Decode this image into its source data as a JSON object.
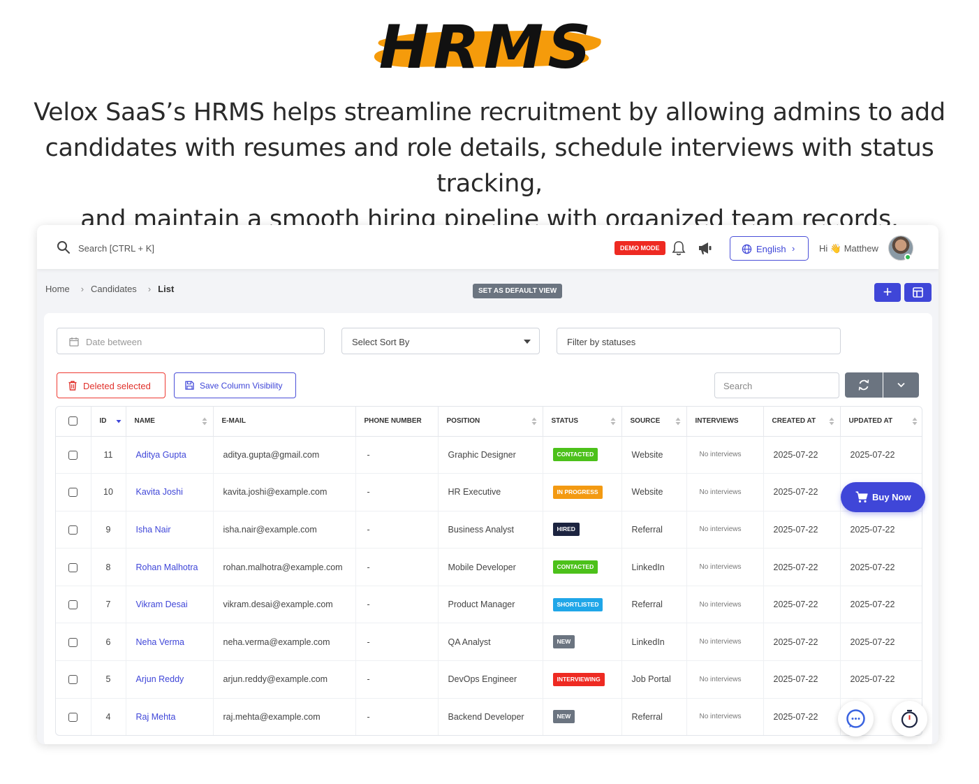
{
  "hero": {
    "logo_text": "HRMS",
    "description_lines": [
      "Velox SaaS’s HRMS helps streamline recruitment by allowing admins to add",
      "candidates with resumes and role details, schedule interviews with status tracking,",
      "and maintain a smooth hiring pipeline with organized team records."
    ]
  },
  "topbar": {
    "search_placeholder": "Search [CTRL + K]",
    "demo_badge": "DEMO MODE",
    "language": "English",
    "greeting_prefix": "Hi",
    "greeting_emoji": "👋",
    "user_name": "Matthew"
  },
  "breadcrumb": {
    "home": "Home",
    "section": "Candidates",
    "current": "List"
  },
  "set_default_view": "SET AS DEFAULT VIEW",
  "filters": {
    "date_placeholder": "Date between",
    "sort_placeholder": "Select Sort By",
    "status_placeholder": "Filter by statuses"
  },
  "actions": {
    "delete_selected": "Deleted selected",
    "save_column_visibility": "Save Column Visibility",
    "search_placeholder": "Search"
  },
  "table": {
    "columns": [
      "ID",
      "NAME",
      "E-MAIL",
      "PHONE NUMBER",
      "POSITION",
      "STATUS",
      "SOURCE",
      "INTERVIEWS",
      "CREATED AT",
      "UPDATED AT"
    ],
    "rows": [
      {
        "id": "11",
        "name": "Aditya Gupta",
        "email": "aditya.gupta@gmail.com",
        "phone": "-",
        "position": "Graphic Designer",
        "status": "CONTACTED",
        "status_color": "#4cc11a",
        "source": "Website",
        "interviews": "No interviews",
        "created": "2025-07-22",
        "updated": "2025-07-22"
      },
      {
        "id": "10",
        "name": "Kavita Joshi",
        "email": "kavita.joshi@example.com",
        "phone": "-",
        "position": "HR Executive",
        "status": "IN PROGRESS",
        "status_color": "#f39a12",
        "source": "Website",
        "interviews": "No interviews",
        "created": "2025-07-22",
        "updated": ""
      },
      {
        "id": "9",
        "name": "Isha Nair",
        "email": "isha.nair@example.com",
        "phone": "-",
        "position": "Business Analyst",
        "status": "HIRED",
        "status_color": "#1c2440",
        "source": "Referral",
        "interviews": "No interviews",
        "created": "2025-07-22",
        "updated": "2025-07-22"
      },
      {
        "id": "8",
        "name": "Rohan Malhotra",
        "email": "rohan.malhotra@example.com",
        "phone": "-",
        "position": "Mobile Developer",
        "status": "CONTACTED",
        "status_color": "#4cc11a",
        "source": "LinkedIn",
        "interviews": "No interviews",
        "created": "2025-07-22",
        "updated": "2025-07-22"
      },
      {
        "id": "7",
        "name": "Vikram Desai",
        "email": "vikram.desai@example.com",
        "phone": "-",
        "position": "Product Manager",
        "status": "SHORTLISTED",
        "status_color": "#1fa6e8",
        "source": "Referral",
        "interviews": "No interviews",
        "created": "2025-07-22",
        "updated": "2025-07-22"
      },
      {
        "id": "6",
        "name": "Neha Verma",
        "email": "neha.verma@example.com",
        "phone": "-",
        "position": "QA Analyst",
        "status": "NEW",
        "status_color": "#6b7480",
        "source": "LinkedIn",
        "interviews": "No interviews",
        "created": "2025-07-22",
        "updated": "2025-07-22"
      },
      {
        "id": "5",
        "name": "Arjun Reddy",
        "email": "arjun.reddy@example.com",
        "phone": "-",
        "position": "DevOps Engineer",
        "status": "INTERVIEWING",
        "status_color": "#ee2a22",
        "source": "Job Portal",
        "interviews": "No interviews",
        "created": "2025-07-22",
        "updated": "2025-07-22"
      },
      {
        "id": "4",
        "name": "Raj Mehta",
        "email": "raj.mehta@example.com",
        "phone": "-",
        "position": "Backend Developer",
        "status": "NEW",
        "status_color": "#6b7480",
        "source": "Referral",
        "interviews": "No interviews",
        "created": "2025-07-22",
        "updated": ""
      }
    ]
  },
  "buy_now": "Buy Now",
  "colors": {
    "primary": "#3f46d8",
    "danger": "#ee2a22",
    "logo_brush": "#f59b0b"
  }
}
